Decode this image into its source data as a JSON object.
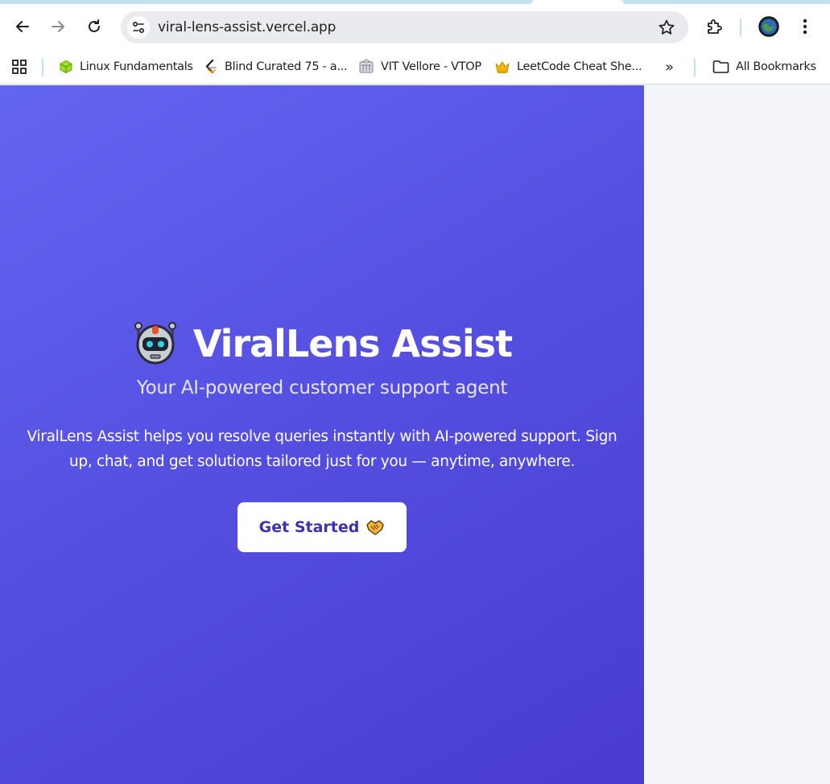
{
  "browser": {
    "url": "viral-lens-assist.vercel.app",
    "bookmarks": [
      {
        "label": "Linux Fundamentals",
        "icon": "cube-icon"
      },
      {
        "label": "Blind Curated 75 - a...",
        "icon": "leetcode-icon"
      },
      {
        "label": "VIT Vellore - VTOP",
        "icon": "vit-icon"
      },
      {
        "label": "LeetCode Cheat She...",
        "icon": "crown-icon"
      }
    ],
    "more_bookmarks": "»",
    "all_bookmarks": "All Bookmarks"
  },
  "hero": {
    "title": "ViralLens Assist",
    "subtitle": "Your AI-powered customer support agent",
    "description": "ViralLens Assist helps you resolve queries instantly with AI-powered support. Sign up, chat, and get solutions tailored just for you — anytime, anywhere.",
    "cta_label": "Get Started"
  },
  "colors": {
    "hero_gradient_start": "#6366f1",
    "hero_gradient_end": "#4a3bd0",
    "cta_text": "#3a31b4"
  }
}
